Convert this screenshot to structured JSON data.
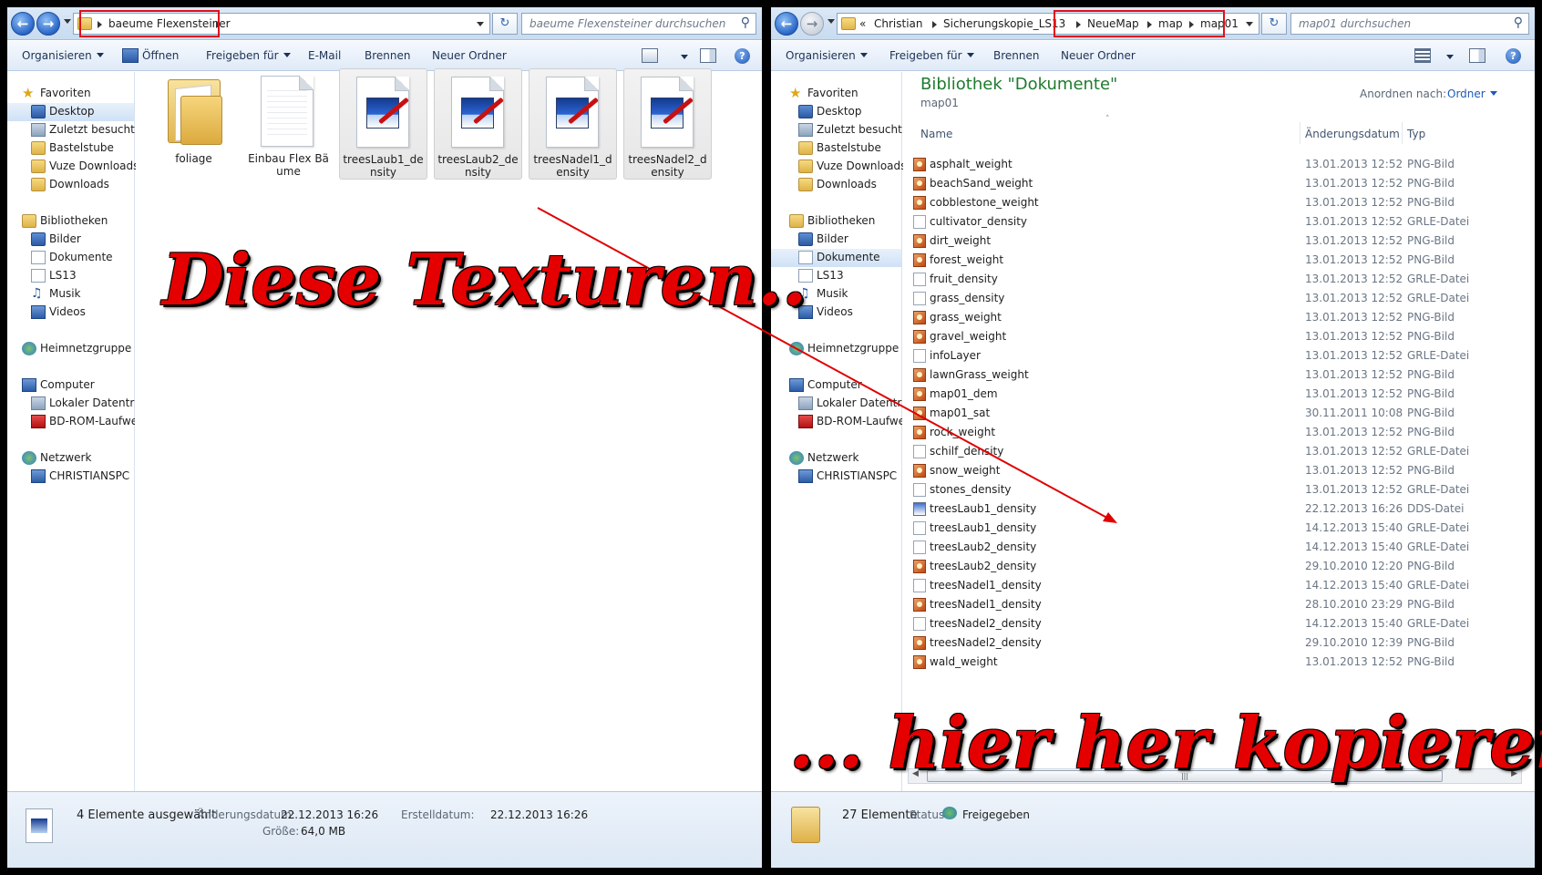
{
  "left": {
    "path": [
      "baeume Flexensteiner"
    ],
    "search_placeholder": "baeume Flexensteiner durchsuchen",
    "toolbar": {
      "organize": "Organisieren",
      "open": "Öffnen",
      "share": "Freigeben für",
      "email": "E-Mail",
      "burn": "Brennen",
      "new_folder": "Neuer Ordner"
    },
    "nav": {
      "favorites": "Favoriten",
      "fav_items": [
        "Desktop",
        "Zuletzt besucht",
        "Bastelstube",
        "Vuze Downloads",
        "Downloads"
      ],
      "libraries": "Bibliotheken",
      "lib_items": [
        "Bilder",
        "Dokumente",
        "LS13",
        "Musik",
        "Videos"
      ],
      "homegroup": "Heimnetzgruppe",
      "computer": "Computer",
      "comp_items": [
        "Lokaler Datenträger",
        "BD-ROM-Laufwe"
      ],
      "network": "Netzwerk",
      "net_items": [
        "CHRISTIANSPC"
      ]
    },
    "tiles": [
      {
        "label": "foliage",
        "kind": "folder"
      },
      {
        "label": "Einbau Flex Bäume",
        "kind": "text"
      },
      {
        "label": "treesLaub1_density",
        "kind": "image"
      },
      {
        "label": "treesLaub2_density",
        "kind": "image"
      },
      {
        "label": "treesNadel1_density",
        "kind": "image"
      },
      {
        "label": "treesNadel2_density",
        "kind": "image"
      }
    ],
    "status": {
      "selected": "4 Elemente ausgewählt",
      "modified_label": "Änderungsdatum:",
      "modified_value": "22.12.2013 16:26",
      "created_label": "Erstelldatum:",
      "created_value": "22.12.2013 16:26",
      "size_label": "Größe:",
      "size_value": "64,0 MB"
    }
  },
  "right": {
    "path": [
      "Christian",
      "Sicherungskopie_LS13",
      "NeueMap",
      "map",
      "map01"
    ],
    "path_prefix": "«",
    "search_placeholder": "map01 durchsuchen",
    "toolbar": {
      "organize": "Organisieren",
      "share": "Freigeben für",
      "burn": "Brennen",
      "new_folder": "Neuer Ordner"
    },
    "nav": {
      "favorites": "Favoriten",
      "fav_items": [
        "Desktop",
        "Zuletzt besucht",
        "Bastelstube",
        "Vuze Downloads",
        "Downloads"
      ],
      "libraries": "Bibliotheken",
      "lib_items": [
        "Bilder",
        "Dokumente",
        "LS13",
        "Musik",
        "Videos"
      ],
      "homegroup": "Heimnetzgruppe",
      "computer": "Computer",
      "comp_items": [
        "Lokaler Datenträg",
        "BD-ROM-Laufwe"
      ],
      "network": "Netzwerk",
      "net_items": [
        "CHRISTIANSPC"
      ]
    },
    "library_title": "Bibliothek \"Dokumente\"",
    "library_sub": "map01",
    "arrange_label": "Anordnen nach:",
    "arrange_value": "Ordner",
    "columns": {
      "name": "Name",
      "date": "Änderungsdatum",
      "type": "Typ"
    },
    "files": [
      {
        "name": "asphalt_weight",
        "date": "13.01.2013 12:52",
        "type": "PNG-Bild"
      },
      {
        "name": "beachSand_weight",
        "date": "13.01.2013 12:52",
        "type": "PNG-Bild"
      },
      {
        "name": "cobblestone_weight",
        "date": "13.01.2013 12:52",
        "type": "PNG-Bild"
      },
      {
        "name": "cultivator_density",
        "date": "13.01.2013 12:52",
        "type": "GRLE-Datei"
      },
      {
        "name": "dirt_weight",
        "date": "13.01.2013 12:52",
        "type": "PNG-Bild"
      },
      {
        "name": "forest_weight",
        "date": "13.01.2013 12:52",
        "type": "PNG-Bild"
      },
      {
        "name": "fruit_density",
        "date": "13.01.2013 12:52",
        "type": "GRLE-Datei"
      },
      {
        "name": "grass_density",
        "date": "13.01.2013 12:52",
        "type": "GRLE-Datei"
      },
      {
        "name": "grass_weight",
        "date": "13.01.2013 12:52",
        "type": "PNG-Bild"
      },
      {
        "name": "gravel_weight",
        "date": "13.01.2013 12:52",
        "type": "PNG-Bild"
      },
      {
        "name": "infoLayer",
        "date": "13.01.2013 12:52",
        "type": "GRLE-Datei"
      },
      {
        "name": "lawnGrass_weight",
        "date": "13.01.2013 12:52",
        "type": "PNG-Bild"
      },
      {
        "name": "map01_dem",
        "date": "13.01.2013 12:52",
        "type": "PNG-Bild"
      },
      {
        "name": "map01_sat",
        "date": "30.11.2011 10:08",
        "type": "PNG-Bild"
      },
      {
        "name": "rock_weight",
        "date": "13.01.2013 12:52",
        "type": "PNG-Bild"
      },
      {
        "name": "schilf_density",
        "date": "13.01.2013 12:52",
        "type": "GRLE-Datei"
      },
      {
        "name": "snow_weight",
        "date": "13.01.2013 12:52",
        "type": "PNG-Bild"
      },
      {
        "name": "stones_density",
        "date": "13.01.2013 12:52",
        "type": "GRLE-Datei"
      },
      {
        "name": "treesLaub1_density",
        "date": "22.12.2013 16:26",
        "type": "DDS-Datei"
      },
      {
        "name": "treesLaub1_density",
        "date": "14.12.2013 15:40",
        "type": "GRLE-Datei"
      },
      {
        "name": "treesLaub2_density",
        "date": "14.12.2013 15:40",
        "type": "GRLE-Datei"
      },
      {
        "name": "treesLaub2_density",
        "date": "29.10.2010 12:20",
        "type": "PNG-Bild"
      },
      {
        "name": "treesNadel1_density",
        "date": "14.12.2013 15:40",
        "type": "GRLE-Datei"
      },
      {
        "name": "treesNadel1_density",
        "date": "28.10.2010 23:29",
        "type": "PNG-Bild"
      },
      {
        "name": "treesNadel2_density",
        "date": "14.12.2013 15:40",
        "type": "GRLE-Datei"
      },
      {
        "name": "treesNadel2_density",
        "date": "29.10.2010 12:39",
        "type": "PNG-Bild"
      },
      {
        "name": "wald_weight",
        "date": "13.01.2013 12:52",
        "type": "PNG-Bild"
      }
    ],
    "status": {
      "count": "27 Elemente",
      "status_label": "Status:",
      "status_value": "Freigegeben"
    }
  },
  "annotations": {
    "top": "Diese Texturen..",
    "bottom": "... hier her kopieren",
    "color": "#e40000"
  }
}
